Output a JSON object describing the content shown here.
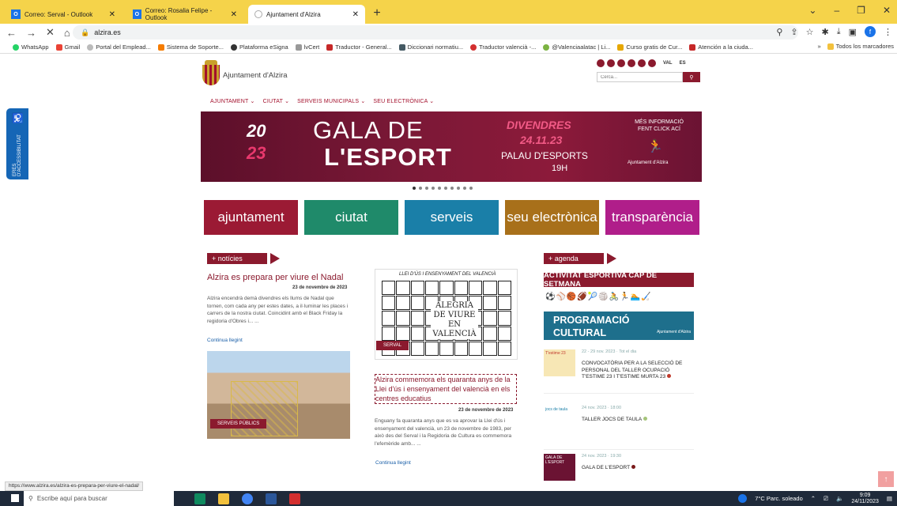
{
  "browser": {
    "tabs": [
      {
        "label": "Correo: Serval - Outlook",
        "icon": "outlook-icon"
      },
      {
        "label": "Correo: Rosalia Felipe - Outlook",
        "icon": "outlook-icon"
      },
      {
        "label": "Ajuntament d'Alzira",
        "icon": "loading-icon"
      }
    ],
    "url": "alzira.es",
    "bookmarks": [
      "WhatsApp",
      "Gmail",
      "Portal del Emplead...",
      "Sistema de Soporte...",
      "Plataforma eSigna",
      "lvCert",
      "Traductor - General...",
      "Diccionari normatiu...",
      "Traductor valencià -...",
      "@Valenciaalatac | Li...",
      "Curso gratis de Cur...",
      "Atención a la ciuda..."
    ],
    "bookmarks_more": "»",
    "bookmarks_folder": "Todos los marcadores",
    "profile_initial": "f"
  },
  "site": {
    "logo_text": "Ajuntament d'Alzira",
    "lang_val": "VAL",
    "lang_es": "ES",
    "search_placeholder": "Cerca...",
    "nav": [
      "AJUNTAMENT ⌄",
      "CIUTAT ⌄",
      "SERVEIS MUNICIPALS ⌄",
      "SEU ELECTRÒNICA ⌄"
    ],
    "accessibility_label": "ERES D'ACCESSIBILITAT",
    "banner": {
      "year1": "20",
      "year2": "23",
      "title1": "GALA DE",
      "title2": "L'ESPORT",
      "day": "DIVENDRES",
      "date": "24.11.23",
      "venue": "PALAU D'ESPORTS",
      "hour": "19H",
      "more_info": "MÉS INFORMACIÓ FENT CLICK ACÍ",
      "org": "Ajuntament d'Alzira"
    },
    "tiles": [
      {
        "label": "ajuntament",
        "color": "#9b1a34"
      },
      {
        "label": "ciutat",
        "color": "#1f8a6a"
      },
      {
        "label": "serveis",
        "color": "#1a7fa8"
      },
      {
        "label": "seu electrònica",
        "color": "#a8701a"
      },
      {
        "label": "transparència",
        "color": "#b01e8a"
      }
    ],
    "news_header": "+ notícies",
    "news1": {
      "title": "Alzira es prepara per viure el Nadal",
      "date": "23 de novembre de 2023",
      "text": "Alzira encendrà demà divendres els llums de Nadal que tornen, com cada any per estes dates, a il·luminar les places i carrers de la nostra ciutat. Coincidint amb el Black Friday la regidoria d'Obres i... ...",
      "link": "Continua llegint",
      "badge": "SERVEIS PÚBLICS"
    },
    "news2": {
      "image_top": "LLEI D'ÚS I ENSENYAMENT DEL VALENCIÀ",
      "image_caption": "ALEGRIA DE VIURE EN VALENCIÀ",
      "badge": "SERVAL",
      "title": "Alzira commemora els quaranta anys de la Llei d'ús i ensenyament del valencià en els centres educatius",
      "date": "23 de novembre de 2023",
      "text": "Enguany fa quaranta anys que es va aprovar la Llei d'ús i ensenyament del valencià, un 23 de novembre de 1983, per això des del Serval i la Regidoria de Cultura es commemora l'efemèride amb... ...",
      "link": "Continua llegint"
    },
    "agenda_header": "+ agenda",
    "agenda_banner1": "ACTIVITAT ESPORTIVA CAP DE SETMANA",
    "agenda_banner2": "PROGRAMACIÓ CULTURAL",
    "agenda_banner2_org": "Ajuntament d'Alzira",
    "events": [
      {
        "meta": "22 - 29 nov. 2023 · Tot el dia",
        "title": "CONVOCATÒRIA PER A LA SELECCIÓ DE PERSONAL DEL TALLER OCUPACIÓ T'ESTIME 23 I T'ESTIME MURTA 23",
        "thumb": "T'estime 23",
        "dot": "#c0392b"
      },
      {
        "meta": "24 nov. 2023 · 18:00",
        "title": "TALLER JOCS DE TAULA",
        "thumb": "jocs de taula",
        "dot": "#a5c47a"
      },
      {
        "meta": "24 nov. 2023 · 19:30",
        "title": "GALA DE L'ESPORT",
        "thumb": "GALA DE L'ESPORT",
        "dot": "#7a1a1a"
      }
    ],
    "status_url": "https://www.alzira.es/alzira-es-prepara-per-viure-el-nadal/"
  },
  "taskbar": {
    "search_placeholder": "Escribe aquí para buscar",
    "weather": "7°C Parc. soleado",
    "time": "9:09",
    "date": "24/11/2023"
  }
}
